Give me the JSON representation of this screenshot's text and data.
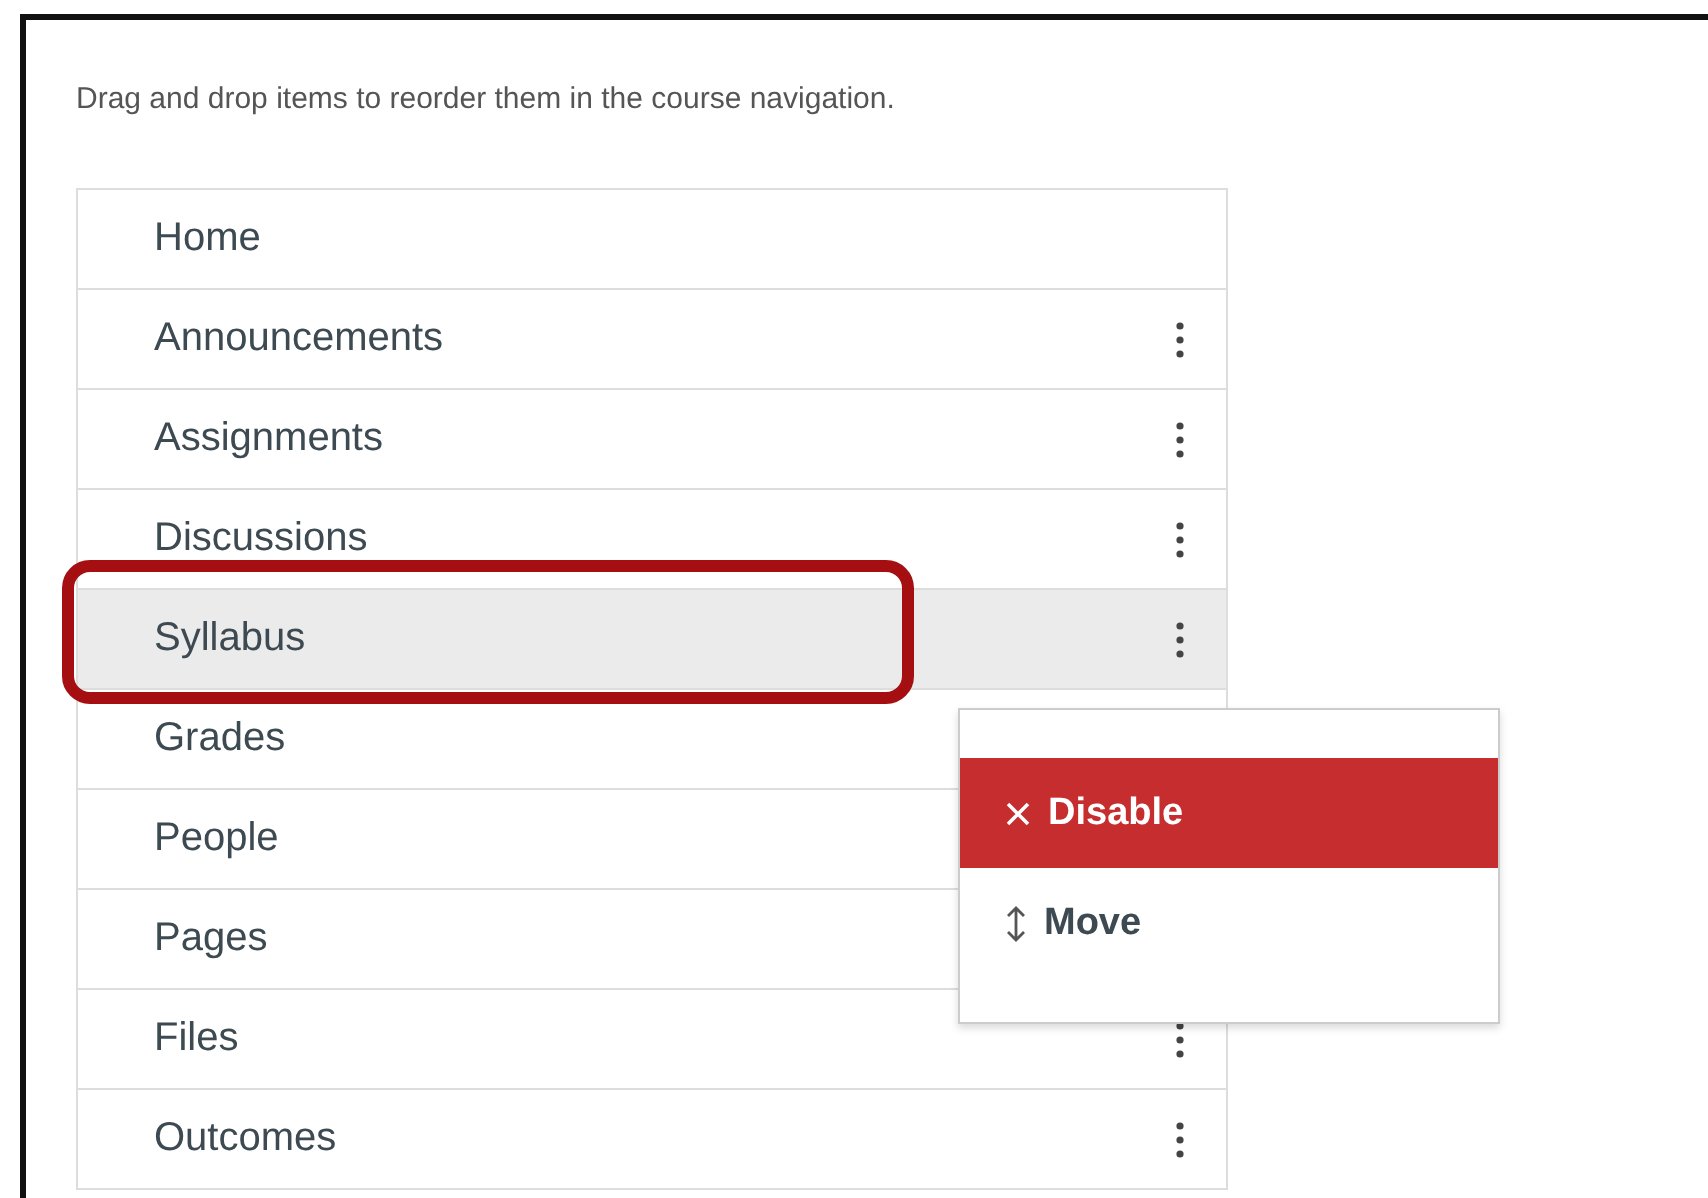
{
  "instructions": "Drag and drop items to reorder them in the course navigation.",
  "nav_items": [
    {
      "label": "Home",
      "kebab": false,
      "selected": false
    },
    {
      "label": "Announcements",
      "kebab": true,
      "selected": false
    },
    {
      "label": "Assignments",
      "kebab": true,
      "selected": false
    },
    {
      "label": "Discussions",
      "kebab": true,
      "selected": false
    },
    {
      "label": "Syllabus",
      "kebab": true,
      "selected": true
    },
    {
      "label": "Grades",
      "selected": false
    },
    {
      "label": "People",
      "selected": false
    },
    {
      "label": "Pages",
      "selected": false
    },
    {
      "label": "Files",
      "kebab": true,
      "selected": false
    },
    {
      "label": "Outcomes",
      "kebab": true,
      "selected": false
    }
  ],
  "menu": [
    {
      "kind": "disable",
      "label": "Disable",
      "selected": true
    },
    {
      "kind": "move",
      "label": "Move",
      "selected": false
    }
  ]
}
